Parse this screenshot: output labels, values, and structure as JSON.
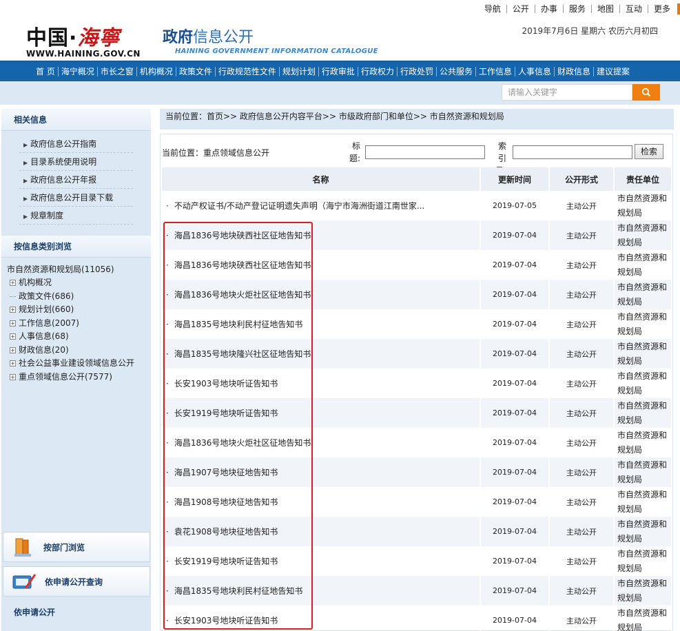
{
  "toplinks": [
    "导航",
    "公开",
    "办事",
    "服务",
    "地图",
    "互动",
    "更多"
  ],
  "header": {
    "logo_cn_black": "中国·",
    "logo_cn_red": "海寧",
    "logo_url": "WWW.HAINING.GOV.CN",
    "title_bold": "政府",
    "title_light": "信息公开",
    "title_en": "HAINING GOVERNMENT INFORMATION CATALOGUE",
    "date": "2019年7月6日  星期六  农历六月初四"
  },
  "nav": [
    "首 页",
    "海宁概况",
    "市长之窗",
    "机构概况",
    "政策文件",
    "行政规范性文件",
    "规划计划",
    "行政审批",
    "行政权力",
    "行政处罚",
    "公共服务",
    "工作信息",
    "人事信息",
    "财政信息",
    "建议提案"
  ],
  "search": {
    "placeholder": "请输入关键字"
  },
  "sidebar": {
    "related_title": "相关信息",
    "related_links": [
      "政府信息公开指南",
      "目录系统使用说明",
      "政府信息公开年报",
      "政府信息公开目录下载",
      "规章制度"
    ],
    "browse_title": "按信息类别浏览",
    "tree_root": "市自然资源和规划局(11056)",
    "tree_items": [
      {
        "label": "机构概况",
        "box": true
      },
      {
        "label": "政策文件(686)",
        "box": false
      },
      {
        "label": "规划计划(660)",
        "box": true
      },
      {
        "label": "工作信息(2007)",
        "box": true
      },
      {
        "label": "人事信息(68)",
        "box": true
      },
      {
        "label": "财政信息(20)",
        "box": true
      },
      {
        "label": "社会公益事业建设领域信息公开",
        "box": true
      },
      {
        "label": "重点领域信息公开(7577)",
        "box": true
      }
    ],
    "btn_dept": "按部门浏览",
    "btn_apply_query": "依申请公开查询",
    "apply_title": "依申请公开"
  },
  "breadcrumb": "当前位置：首页>>  政府信息公开内容平台>>  市级政府部门和单位>>  市自然资源和规划局",
  "filter": {
    "position": "当前位置：重点领域信息公开",
    "title_label": "标题:",
    "index_label": "索引号:",
    "search_btn": "检索"
  },
  "table": {
    "headers": [
      "名称",
      "更新时间",
      "公开形式",
      "责任单位"
    ],
    "rows": [
      {
        "name": "不动产权证书/不动产登记证明遗失声明（海宁市海洲街道江南世家...",
        "date": "2019-07-05",
        "form": "主动公开",
        "unit": "市自然资源和规划局"
      },
      {
        "name": "海昌1836号地块硖西社区征地告知书",
        "date": "2019-07-04",
        "form": "主动公开",
        "unit": "市自然资源和规划局"
      },
      {
        "name": "海昌1836号地块硖西社区征地告知书",
        "date": "2019-07-04",
        "form": "主动公开",
        "unit": "市自然资源和规划局"
      },
      {
        "name": "海昌1836号地块火炬社区征地告知书",
        "date": "2019-07-04",
        "form": "主动公开",
        "unit": "市自然资源和规划局"
      },
      {
        "name": "海昌1835号地块利民村征地告知书",
        "date": "2019-07-04",
        "form": "主动公开",
        "unit": "市自然资源和规划局"
      },
      {
        "name": "海昌1835号地块隆兴社区征地告知书",
        "date": "2019-07-04",
        "form": "主动公开",
        "unit": "市自然资源和规划局"
      },
      {
        "name": "长安1903号地块听证告知书",
        "date": "2019-07-04",
        "form": "主动公开",
        "unit": "市自然资源和规划局"
      },
      {
        "name": "长安1919号地块听证告知书",
        "date": "2019-07-04",
        "form": "主动公开",
        "unit": "市自然资源和规划局"
      },
      {
        "name": "海昌1836号地块火炬社区征地告知书",
        "date": "2019-07-04",
        "form": "主动公开",
        "unit": "市自然资源和规划局"
      },
      {
        "name": "海昌1907号地块征地告知书",
        "date": "2019-07-04",
        "form": "主动公开",
        "unit": "市自然资源和规划局"
      },
      {
        "name": "海昌1908号地块征地告知书",
        "date": "2019-07-04",
        "form": "主动公开",
        "unit": "市自然资源和规划局"
      },
      {
        "name": "袁花1908号地块征地告知书",
        "date": "2019-07-04",
        "form": "主动公开",
        "unit": "市自然资源和规划局"
      },
      {
        "name": "长安1919号地块听证告知书",
        "date": "2019-07-04",
        "form": "主动公开",
        "unit": "市自然资源和规划局"
      },
      {
        "name": "海昌1835号地块利民村征地告知书",
        "date": "2019-07-04",
        "form": "主动公开",
        "unit": "市自然资源和规划局"
      },
      {
        "name": "长安1903号地块听证告知书",
        "date": "2019-07-04",
        "form": "主动公开",
        "unit": "市自然资源和规划局"
      }
    ]
  },
  "colors": {
    "nav_bg": "#1565ad",
    "accent": "#f07f12",
    "panel_bg": "#dce9f5",
    "highlight": "#d62020"
  },
  "icons": {
    "search": "search-icon",
    "dept": "books-icon",
    "apply": "pen-icon"
  }
}
